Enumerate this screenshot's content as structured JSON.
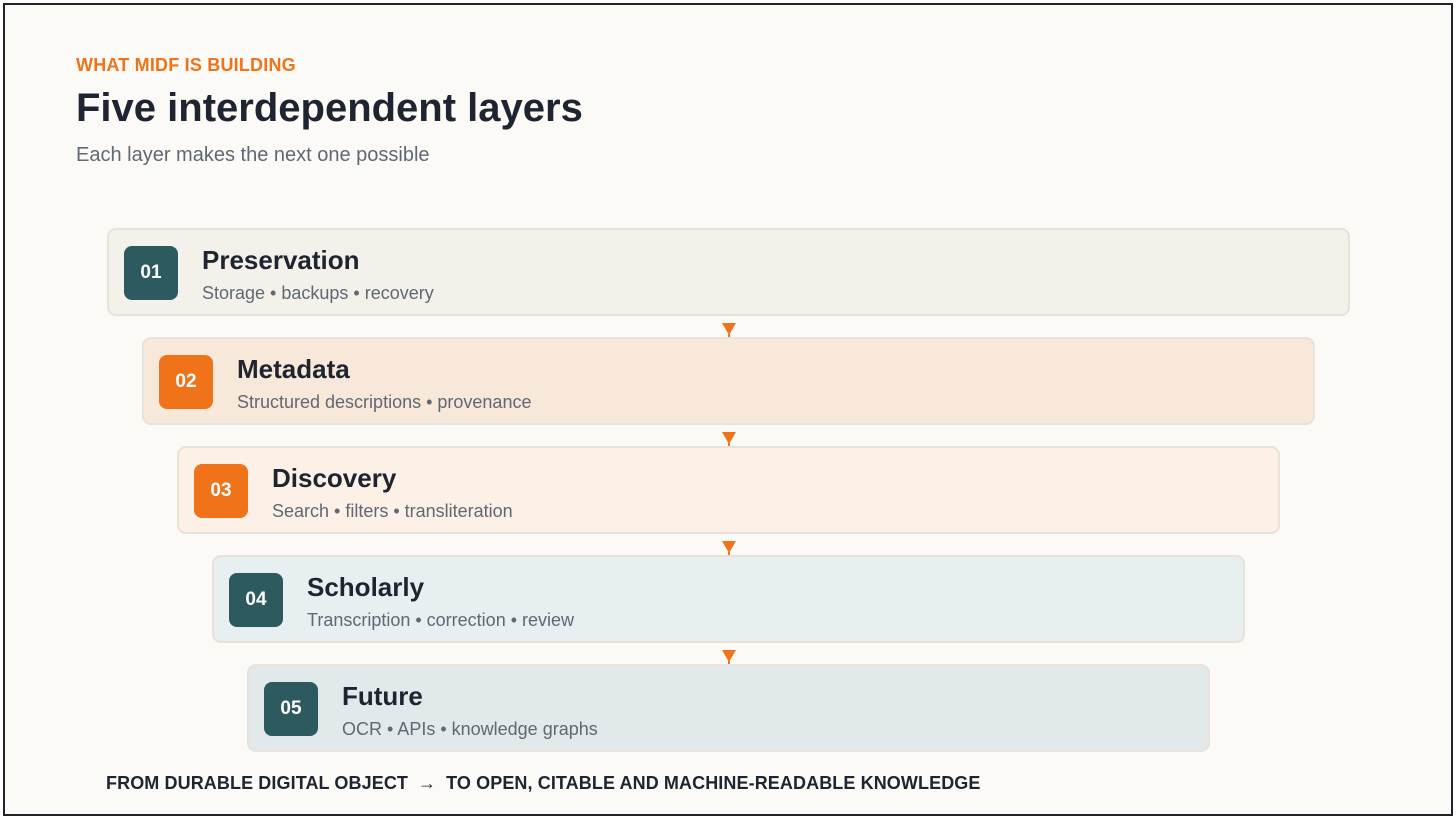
{
  "header": {
    "eyebrow": "WHAT MIDF IS BUILDING",
    "title": "Five interdependent layers",
    "subtitle": "Each layer makes the next one possible"
  },
  "layers": [
    {
      "number": "01",
      "name": "Preservation",
      "description": "Storage • backups • recovery",
      "badge_color": "#2d5a5e",
      "fill_color": "#f4f0ea"
    },
    {
      "number": "02",
      "name": "Metadata",
      "description": "Structured descriptions • provenance",
      "badge_color": "#f07219",
      "fill_color": "#f8e8d9"
    },
    {
      "number": "03",
      "name": "Discovery",
      "description": "Search • filters • transliteration",
      "badge_color": "#f07219",
      "fill_color": "#fdf0e6"
    },
    {
      "number": "04",
      "name": "Scholarly",
      "description": "Transcription • correction • review",
      "badge_color": "#2d5a5e",
      "fill_color": "#e7eff0"
    },
    {
      "number": "05",
      "name": "Future",
      "description": "OCR • APIs • knowledge graphs",
      "badge_color": "#2d5a5e",
      "fill_color": "#e1e9ea"
    }
  ],
  "footer": {
    "from_text": "FROM DURABLE DIGITAL OBJECT",
    "arrow": "→",
    "to_text": "TO OPEN, CITABLE AND MACHINE-READABLE KNOWLEDGE"
  },
  "colors": {
    "accent": "#f07219",
    "teal": "#2d5a5e",
    "text_dark": "#1e2430",
    "text_muted": "#5f6873"
  },
  "icons": [
    "down-arrow-icon"
  ]
}
